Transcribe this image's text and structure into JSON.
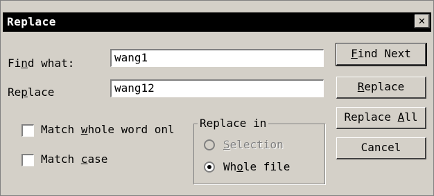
{
  "window": {
    "title": "Replace",
    "close_glyph": "✕"
  },
  "find_what": {
    "label_pre": "Fi",
    "label_key": "n",
    "label_post": "d what:",
    "value": "wang1"
  },
  "replace_with": {
    "label_pre": "Re",
    "label_key": "p",
    "label_post": "lace",
    "value": "wang12"
  },
  "options": {
    "match_whole_word": {
      "pre": "Match ",
      "key": "w",
      "post": "hole word onl",
      "checked": false
    },
    "match_case": {
      "pre": "Match ",
      "key": "c",
      "post": "ase",
      "checked": false
    }
  },
  "replace_in": {
    "title": "Replace in",
    "selection": {
      "pre": "",
      "key": "S",
      "post": "election",
      "enabled": false,
      "selected": false
    },
    "whole_file": {
      "pre": "Wh",
      "key": "o",
      "post": "le file",
      "enabled": true,
      "selected": true
    }
  },
  "buttons": {
    "find_next": {
      "pre": "",
      "key": "F",
      "post": "ind Next"
    },
    "replace": {
      "pre": "",
      "key": "R",
      "post": "eplace"
    },
    "replace_all": {
      "pre": "Replace ",
      "key": "A",
      "post": "ll"
    },
    "cancel": {
      "pre": "Cancel",
      "key": "",
      "post": ""
    }
  },
  "colors": {
    "face": "#d4d0c8",
    "titlebar": "#000000",
    "title_text": "#ffffff",
    "disabled_text": "#808080"
  }
}
